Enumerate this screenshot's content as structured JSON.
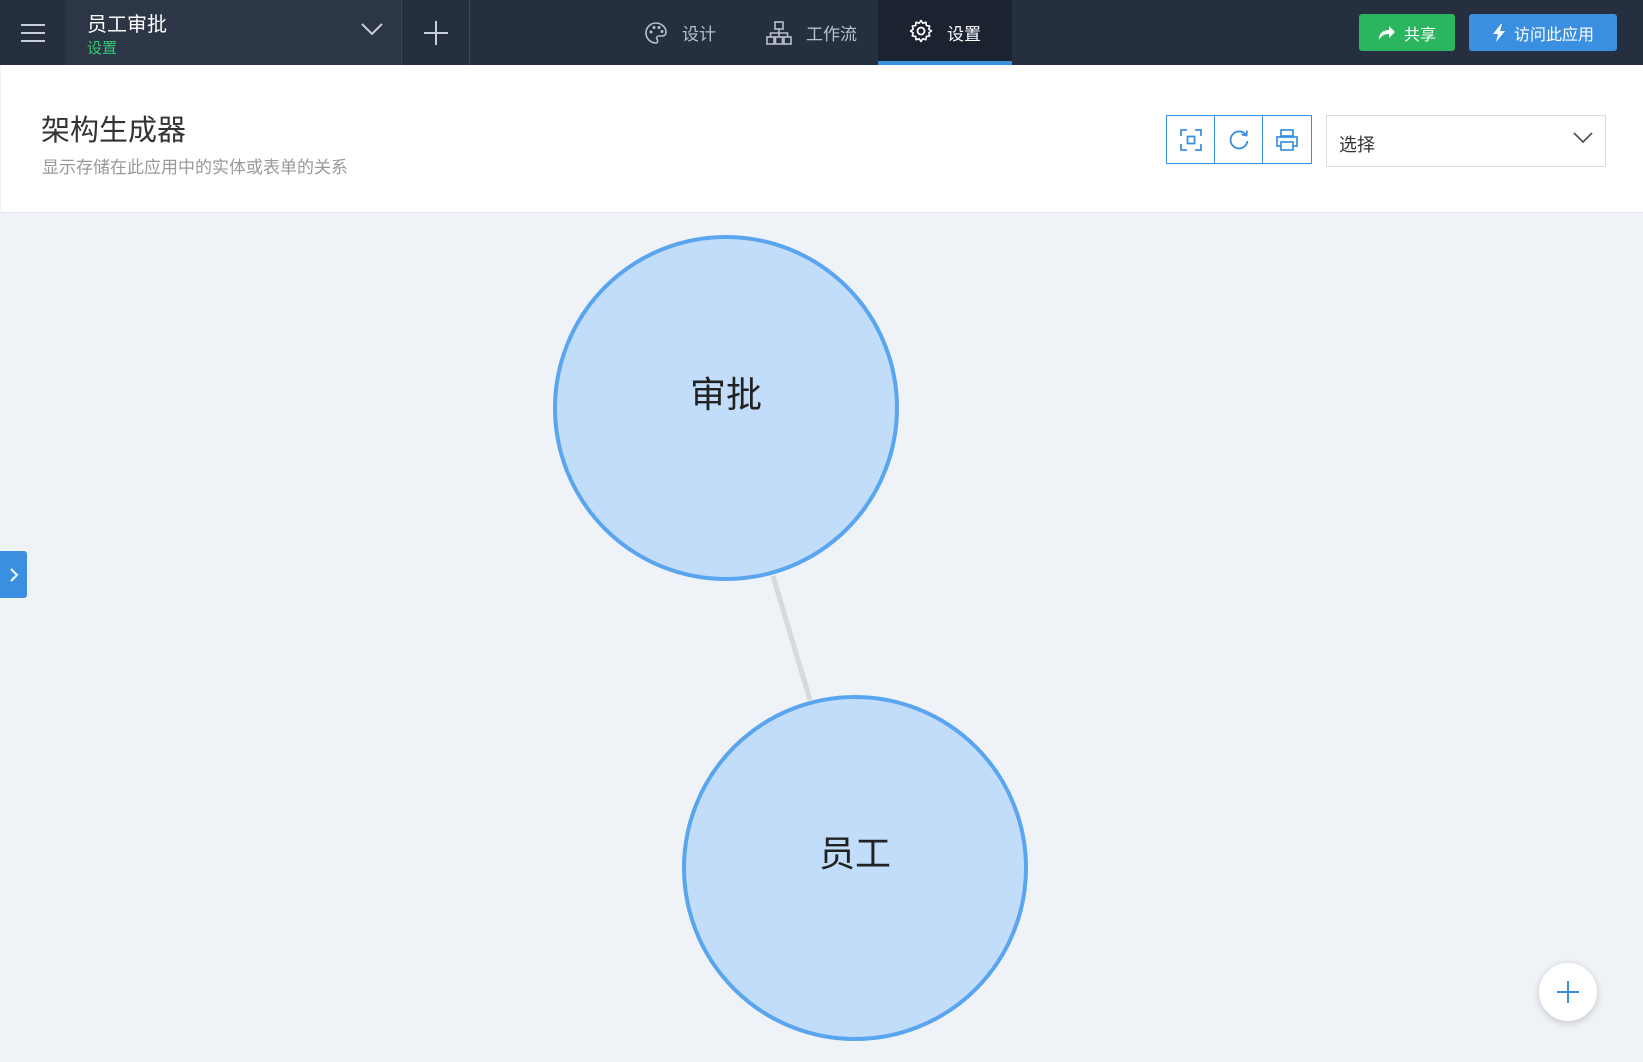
{
  "app": {
    "name": "员工审批",
    "section": "设置"
  },
  "tabs": [
    {
      "label": "设计",
      "icon": "palette-icon"
    },
    {
      "label": "工作流",
      "icon": "workflow-icon"
    },
    {
      "label": "设置",
      "icon": "gear-icon",
      "active": true
    }
  ],
  "actions": {
    "share_label": "共享",
    "visit_label": "访问此应用"
  },
  "header": {
    "title": "架构生成器",
    "description": "显示存储在此应用中的实体或表单的关系"
  },
  "toolbar": {
    "buttons": [
      "fit-screen-icon",
      "refresh-icon",
      "print-icon"
    ],
    "select_value": "选择"
  },
  "diagram": {
    "nodes": [
      {
        "id": "approval",
        "label": "审批"
      },
      {
        "id": "employee",
        "label": "员工"
      }
    ],
    "edges": [
      {
        "from": "approval",
        "to": "employee"
      }
    ]
  },
  "colors": {
    "topbar": "#262f3f",
    "accent": "#3b8fe0",
    "share": "#2bb55e",
    "node_fill": "#c2ddf9",
    "node_stroke": "#5aa5ef",
    "edge": "#d7d9dc",
    "canvas": "#eff2f7"
  }
}
